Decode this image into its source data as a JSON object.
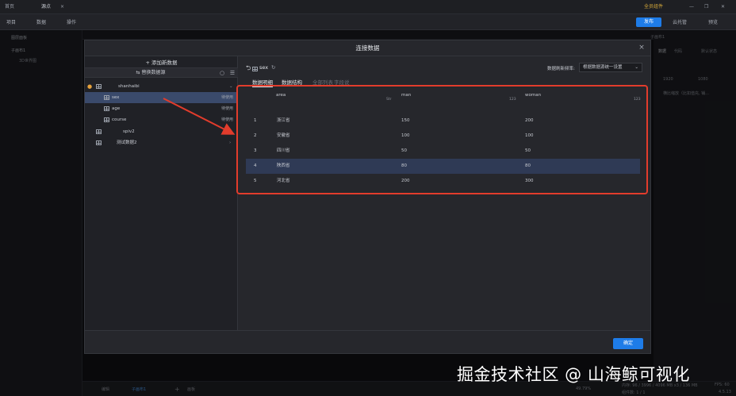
{
  "topbar": {
    "tabs": [
      "首页",
      "源点",
      "×"
    ],
    "vip_label": "全员组件"
  },
  "toolbar": {
    "items": [
      "项目",
      "数据",
      "操作"
    ],
    "publish_label": "发布",
    "cloud_label": "云托管",
    "preview_label": "预览"
  },
  "leftpanel": {
    "title": "图层面板",
    "items": [
      "子画布1",
      "3D世界图"
    ]
  },
  "rightpanel": {
    "labels": [
      "子画布1",
      "数据",
      "代码",
      "默认状态"
    ],
    "inputs": [
      "1920",
      "1080"
    ],
    "option": "横比缩放（比如值充, 铺..."
  },
  "modal": {
    "title": "连接数据",
    "close": "×",
    "confirm_label": "确定"
  },
  "datasources": {
    "add_label": "+ 添加新数据",
    "switch_label": "替换数据源",
    "groups": [
      {
        "name": "shanhaibi",
        "expanded": true
      },
      {
        "name": "sex",
        "badge": "待使用",
        "selected": true
      },
      {
        "name": "age",
        "badge": "待使用"
      },
      {
        "name": "course",
        "badge": "待使用"
      },
      {
        "name": "spiv2",
        "badge": ""
      },
      {
        "name": "测试数据2",
        "badge": ""
      }
    ]
  },
  "content": {
    "back": "⮌",
    "title": "sex",
    "title_extra": "↻",
    "refresh_label": "数据刷新频率:",
    "refresh_value": "根据数据源统一设置",
    "tabs": [
      "数据明细",
      "数据结构",
      "全部列表",
      "字段说"
    ],
    "columns": [
      {
        "name": "area",
        "type": "Str"
      },
      {
        "name": "man",
        "type": "123"
      },
      {
        "name": "woman",
        "type": "123"
      }
    ],
    "rows": [
      {
        "index": "1",
        "area": "浙江省",
        "man": "150",
        "woman": "200"
      },
      {
        "index": "2",
        "area": "安徽省",
        "man": "100",
        "woman": "100"
      },
      {
        "index": "3",
        "area": "四川省",
        "man": "50",
        "woman": "50"
      },
      {
        "index": "4",
        "area": "陕西省",
        "man": "80",
        "woman": "80"
      },
      {
        "index": "5",
        "area": "河北省",
        "man": "200",
        "woman": "300"
      }
    ]
  },
  "bottombar": {
    "items": [
      "编辑",
      "子画布1",
      "+",
      "画板"
    ],
    "zoom": "49.79%",
    "memory": "内存: 96 / 3996 / 4096 MB  x3 / 136 MB",
    "fps": "FPS: 60",
    "version": "4.5.13",
    "canvas_count": "组件数: 1 / 1"
  },
  "watermark": "掘金技术社区 @ 山海鲸可视化",
  "colors": {
    "accent": "#1e7ce8",
    "highlight_red": "#e23c2c",
    "selected_row": "#3a4a6b"
  }
}
